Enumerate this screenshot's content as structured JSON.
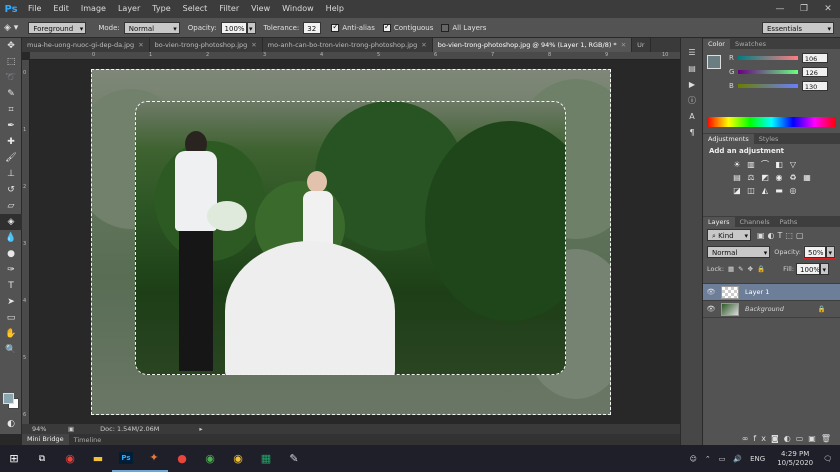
{
  "app": {
    "logo": "Ps",
    "menus": [
      "File",
      "Edit",
      "Image",
      "Layer",
      "Type",
      "Select",
      "Filter",
      "View",
      "Window",
      "Help"
    ],
    "window_controls": [
      "—",
      "❐",
      "✕"
    ]
  },
  "options": {
    "fill_source": "Foreground",
    "mode_label": "Mode:",
    "mode_value": "Normal",
    "opacity_label": "Opacity:",
    "opacity_value": "100%",
    "tolerance_label": "Tolerance:",
    "tolerance_value": "32",
    "anti_alias": "Anti-alias",
    "contiguous": "Contiguous",
    "all_layers": "All Layers",
    "workspace": "Essentials"
  },
  "tabs": [
    {
      "label": "mua-he-uong-nuoc-gi-dep-da.jpg"
    },
    {
      "label": "bo-vien-trong-photoshop.jpg"
    },
    {
      "label": "mo-anh-can-bo-tron-vien-trong-photoshop.jpg"
    },
    {
      "label": "bo-vien-trong-photoshop.jpg @ 94% (Layer 1, RGB/8) *"
    },
    {
      "label": "Ur"
    }
  ],
  "status": {
    "zoom": "94%",
    "doc": "Doc: 1.54M/2.06M"
  },
  "bottom_tabs": [
    "Mini Bridge",
    "Timeline"
  ],
  "color_panel": {
    "tabs": [
      "Color",
      "Swatches"
    ],
    "r_label": "R",
    "r_value": "106",
    "g_label": "G",
    "g_value": "126",
    "b_label": "B",
    "b_value": "130",
    "color_hex": "#6a7e82"
  },
  "adjustments_panel": {
    "tabs": [
      "Adjustments",
      "Styles"
    ],
    "title": "Add an adjustment"
  },
  "layers_panel": {
    "tabs": [
      "Layers",
      "Channels",
      "Paths"
    ],
    "kind": "Kind",
    "blend": "Normal",
    "opacity_label": "Opacity:",
    "opacity_value": "50%",
    "lock_label": "Lock:",
    "fill_label": "Fill:",
    "fill_value": "100%",
    "layers": [
      {
        "name": "Layer 1",
        "selected": true
      },
      {
        "name": "Background",
        "selected": false
      }
    ]
  },
  "taskbar": {
    "lang": "ENG",
    "time": "4:29 PM",
    "date": "10/5/2020"
  },
  "colors": {
    "highlight": "#e02020",
    "selected_layer": "#6d7e98",
    "taskbar_accent": "#6ea6d8"
  }
}
